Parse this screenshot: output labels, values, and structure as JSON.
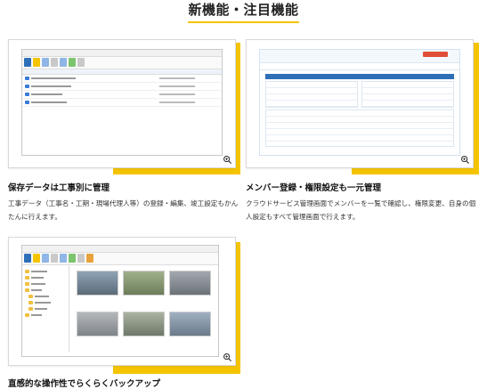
{
  "section": {
    "title": "新機能・注目機能"
  },
  "cards": [
    {
      "title": "保存データは工事別に管理",
      "description": "工事データ（工事名・工期・現場代理人等）の登録・編集、竣工設定もかんたんに行えます。",
      "zoom_icon": "magnifier-plus-icon"
    },
    {
      "title": "メンバー登録・権限設定も一元管理",
      "description": "クラウドサービス管理画面でメンバーを一覧で確認し、権限変更、自身の個人設定もすべて管理画面で行えます。",
      "zoom_icon": "magnifier-plus-icon"
    },
    {
      "title": "直感的な操作性でらくらくバックアップ",
      "zoom_icon": "magnifier-plus-icon"
    }
  ],
  "colors": {
    "accent": "#f5c400",
    "brand_blue": "#2f6fb8",
    "cloud_blue": "#4aa3df"
  }
}
